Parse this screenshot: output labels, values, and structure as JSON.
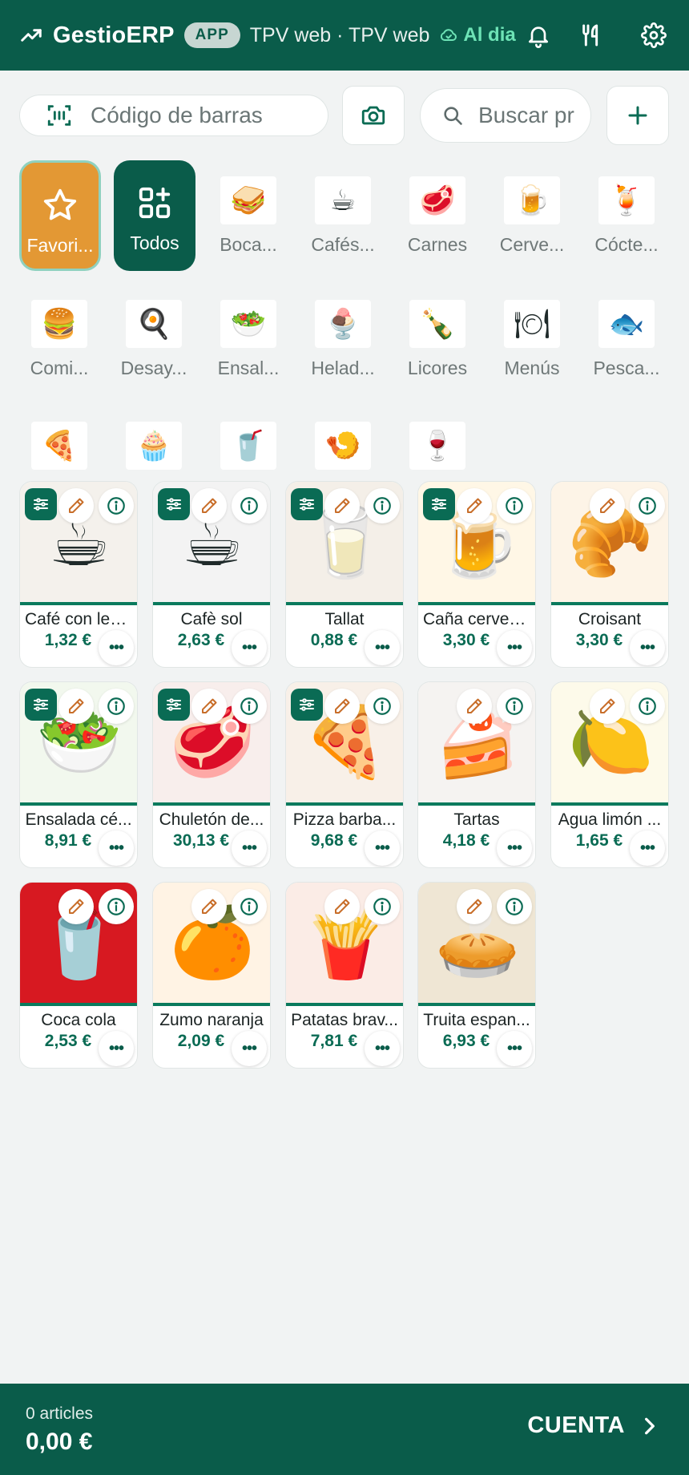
{
  "header": {
    "brand": "GestioERP",
    "badge": "APP",
    "subtitle": "TPV web · TPV web",
    "sync_status": "Al dia",
    "icons": [
      "trending-up-icon",
      "bell-icon",
      "cutlery-icon",
      "gear-icon"
    ]
  },
  "search": {
    "barcode_placeholder": "Código de barras",
    "search_placeholder": "Buscar pr"
  },
  "categories": [
    {
      "label": "Favori...",
      "icon": "star-icon"
    },
    {
      "label": "Todos",
      "icon": "grid-plus-icon"
    },
    {
      "label": "Boca...",
      "emoji": "🥪"
    },
    {
      "label": "Cafés...",
      "emoji": "☕"
    },
    {
      "label": "Carnes",
      "emoji": "🥩"
    },
    {
      "label": "Cerve...",
      "emoji": "🍺"
    },
    {
      "label": "Cócte...",
      "emoji": "🍹"
    },
    {
      "label": "Comi...",
      "emoji": "🍔"
    },
    {
      "label": "Desay...",
      "emoji": "🍳"
    },
    {
      "label": "Ensal...",
      "emoji": "🥗"
    },
    {
      "label": "Helad...",
      "emoji": "🍨"
    },
    {
      "label": "Licores",
      "emoji": "🍾"
    },
    {
      "label": "Menús",
      "emoji": "🍽"
    },
    {
      "label": "Pesca...",
      "emoji": "🐟"
    },
    {
      "label": "",
      "emoji": "🍕"
    },
    {
      "label": "",
      "emoji": "🧁"
    },
    {
      "label": "",
      "emoji": "🥤"
    },
    {
      "label": "",
      "emoji": "🍤"
    },
    {
      "label": "",
      "emoji": "🍷"
    }
  ],
  "products": [
    {
      "name": "Café con lec...",
      "price": "1,32 €",
      "emoji": "☕",
      "options": true,
      "bg": "#f4f1ec"
    },
    {
      "name": "Cafè sol",
      "price": "2,63 €",
      "emoji": "☕",
      "options": true,
      "bg": "#f3f3f3"
    },
    {
      "name": "Tallat",
      "price": "0,88 €",
      "emoji": "🥛",
      "options": true,
      "bg": "#f4efe8"
    },
    {
      "name": "Caña cervez...",
      "price": "3,30 €",
      "emoji": "🍺",
      "options": true,
      "bg": "#fff7e6"
    },
    {
      "name": "Croisant",
      "price": "3,30 €",
      "emoji": "🥐",
      "options": false,
      "bg": "#fdf4e7"
    },
    {
      "name": "Ensalada cé...",
      "price": "8,91 €",
      "emoji": "🥗",
      "options": true,
      "bg": "#f2f8ee"
    },
    {
      "name": "Chuletón de...",
      "price": "30,13 €",
      "emoji": "🥩",
      "options": true,
      "bg": "#f8eeec"
    },
    {
      "name": "Pizza barba...",
      "price": "9,68 €",
      "emoji": "🍕",
      "options": true,
      "bg": "#f8f0e8"
    },
    {
      "name": "Tartas",
      "price": "4,18 €",
      "emoji": "🍰",
      "options": false,
      "bg": "#f5f3f1"
    },
    {
      "name": "Agua limón ...",
      "price": "1,65 €",
      "emoji": "🍋",
      "options": false,
      "bg": "#fdfaea"
    },
    {
      "name": "Coca cola",
      "price": "2,53 €",
      "emoji": "🥤",
      "options": false,
      "bg": "#d71921"
    },
    {
      "name": "Zumo naranja",
      "price": "2,09 €",
      "emoji": "🍊",
      "options": false,
      "bg": "#fff3e4"
    },
    {
      "name": "Patatas brav...",
      "price": "7,81 €",
      "emoji": "🍟",
      "options": false,
      "bg": "#fbece6"
    },
    {
      "name": "Truita espan...",
      "price": "6,93 €",
      "emoji": "🥧",
      "options": false,
      "bg": "#efe6d4"
    }
  ],
  "cart": {
    "count": "0 articles",
    "total": "0,00 €",
    "button": "CUENTA"
  },
  "colors": {
    "primary": "#0a5c4a",
    "accent": "#e39834",
    "sync": "#6ee3b6",
    "edit": "#c86e2a"
  }
}
